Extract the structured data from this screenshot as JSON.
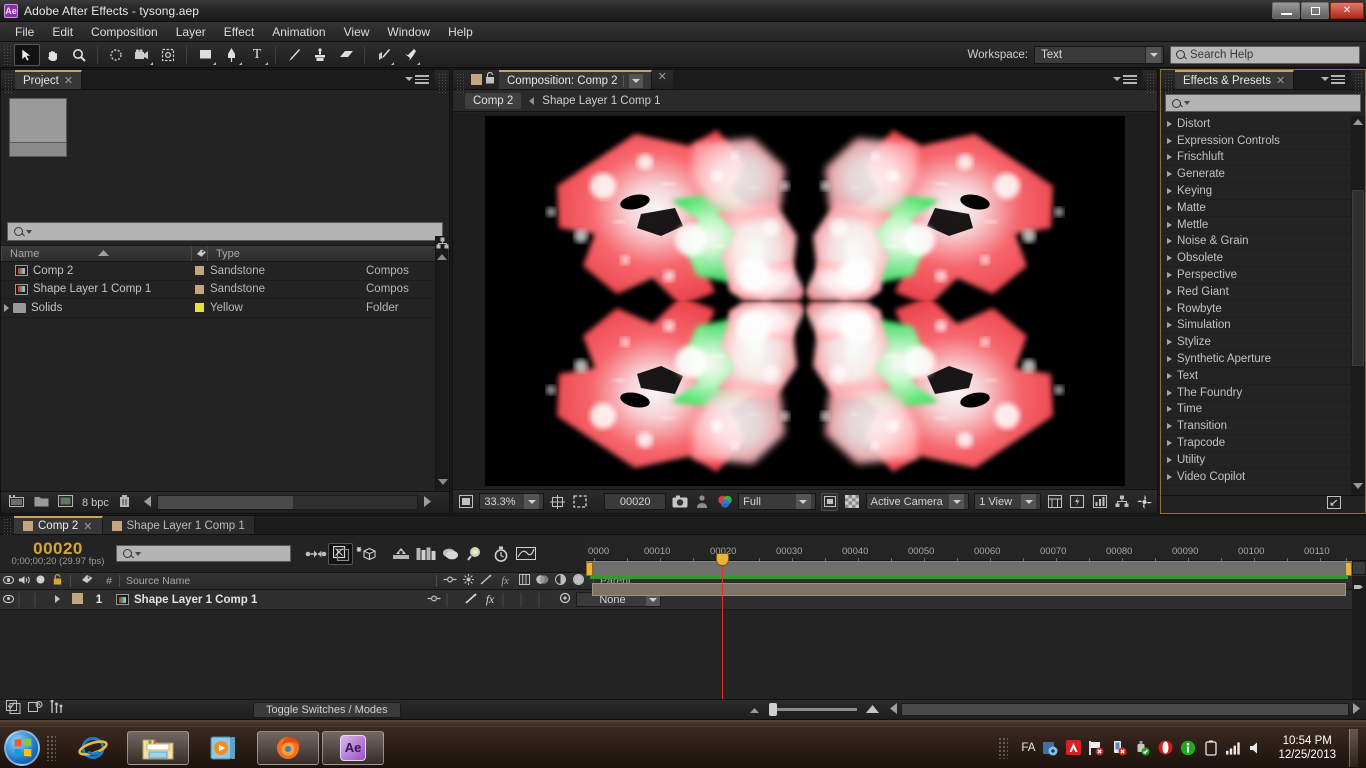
{
  "window": {
    "app_badge": "Ae",
    "title": "Adobe After Effects - tysong.aep",
    "minimize": "–",
    "maximize": "❐",
    "close": "✕"
  },
  "menubar": {
    "items": [
      "File",
      "Edit",
      "Composition",
      "Layer",
      "Effect",
      "Animation",
      "View",
      "Window",
      "Help"
    ]
  },
  "toolbar": {
    "tools": [
      {
        "name": "selection-tool",
        "glyph": "➤",
        "selected": true
      },
      {
        "name": "hand-tool",
        "glyph": "✋",
        "selected": false
      },
      {
        "name": "zoom-tool",
        "glyph": "⚲",
        "selected": false
      },
      {
        "name": "rotation-tool",
        "glyph": "⟳",
        "selected": false
      },
      {
        "name": "camera-tool",
        "glyph": "Ἲ5",
        "selected": false
      },
      {
        "name": "pan-behind-tool",
        "glyph": "✥",
        "selected": false
      },
      {
        "name": "shape-tool",
        "glyph": "■",
        "selected": false
      },
      {
        "name": "pen-tool",
        "glyph": "✒",
        "selected": false
      },
      {
        "name": "type-tool",
        "glyph": "T",
        "selected": false
      },
      {
        "name": "brush-tool",
        "glyph": "╱",
        "selected": false
      },
      {
        "name": "clone-stamp-tool",
        "glyph": "⚓",
        "selected": false
      },
      {
        "name": "eraser-tool",
        "glyph": "▱",
        "selected": false
      },
      {
        "name": "roto-brush-tool",
        "glyph": "✎",
        "selected": false
      },
      {
        "name": "puppet-pin-tool",
        "glyph": "✐",
        "selected": false
      }
    ],
    "workspace_label": "Workspace:",
    "workspace_value": "Text",
    "search_help_placeholder": "Search Help"
  },
  "project_panel": {
    "tab_label": "Project",
    "search_placeholder": "",
    "columns": [
      "Name",
      "Type"
    ],
    "items": [
      {
        "name": "Comp 2",
        "label": "Sandstone",
        "label_color": "#c3a680",
        "type": "Compos",
        "kind": "composition"
      },
      {
        "name": "Shape Layer 1 Comp 1",
        "label": "Sandstone",
        "label_color": "#c3a680",
        "type": "Compos",
        "kind": "composition"
      },
      {
        "name": "Solids",
        "label": "Yellow",
        "label_color": "#e8e03a",
        "type": "Folder",
        "kind": "folder"
      }
    ],
    "bit_depth": "8 bpc"
  },
  "comp_panel": {
    "tab_label": "Composition: Comp 2",
    "breadcrumb": {
      "current": "Comp 2",
      "parent": "Shape Layer 1 Comp 1"
    },
    "viewer_controls": {
      "zoom": "33.3%",
      "timecode": "00020",
      "resolution": "Full",
      "camera": "Active Camera",
      "views": "1 View"
    }
  },
  "effects_panel": {
    "tab_label": "Effects & Presets",
    "search_placeholder": "",
    "categories": [
      "Distort",
      "Expression Controls",
      "Frischluft",
      "Generate",
      "Keying",
      "Matte",
      "Mettle",
      "Noise & Grain",
      "Obsolete",
      "Perspective",
      "Red Giant",
      "Rowbyte",
      "Simulation",
      "Stylize",
      "Synthetic Aperture",
      "Text",
      "The Foundry",
      "Time",
      "Transition",
      "Trapcode",
      "Utility",
      "Video Copilot"
    ]
  },
  "timeline": {
    "tabs": [
      {
        "label": "Comp 2",
        "active": true
      },
      {
        "label": "Shape Layer 1 Comp 1",
        "active": false
      }
    ],
    "current_time_frames": "00020",
    "current_time_detail": "0;00;00;20 (29.97 fps)",
    "search_placeholder": "",
    "column_headers": [
      "Source Name",
      "Parent"
    ],
    "layers": [
      {
        "index": "1",
        "source_name": "Shape Layer 1 Comp 1",
        "parent": "None",
        "label_color": "#c3a680"
      }
    ],
    "ruler_ticks": [
      "0000",
      "00010",
      "00020",
      "00030",
      "00040",
      "00050",
      "00060",
      "00070",
      "00080",
      "00090",
      "00100",
      "00110"
    ],
    "toggle_switches_modes": "Toggle Switches / Modes"
  },
  "taskbar": {
    "buttons": [
      {
        "name": "internet-explorer",
        "active": false
      },
      {
        "name": "windows-explorer",
        "active": true
      },
      {
        "name": "media-player",
        "active": false
      },
      {
        "name": "firefox",
        "active": true
      },
      {
        "name": "after-effects",
        "active": true
      }
    ],
    "language": "FA",
    "time": "10:54 PM",
    "date": "12/25/2013"
  },
  "colors": {
    "accent_gold": "#c8a45c",
    "timecode_gold": "#d6a531",
    "playhead_red": "#e03030",
    "render_green": "#2aa02a",
    "panel_bg": "#232323"
  }
}
